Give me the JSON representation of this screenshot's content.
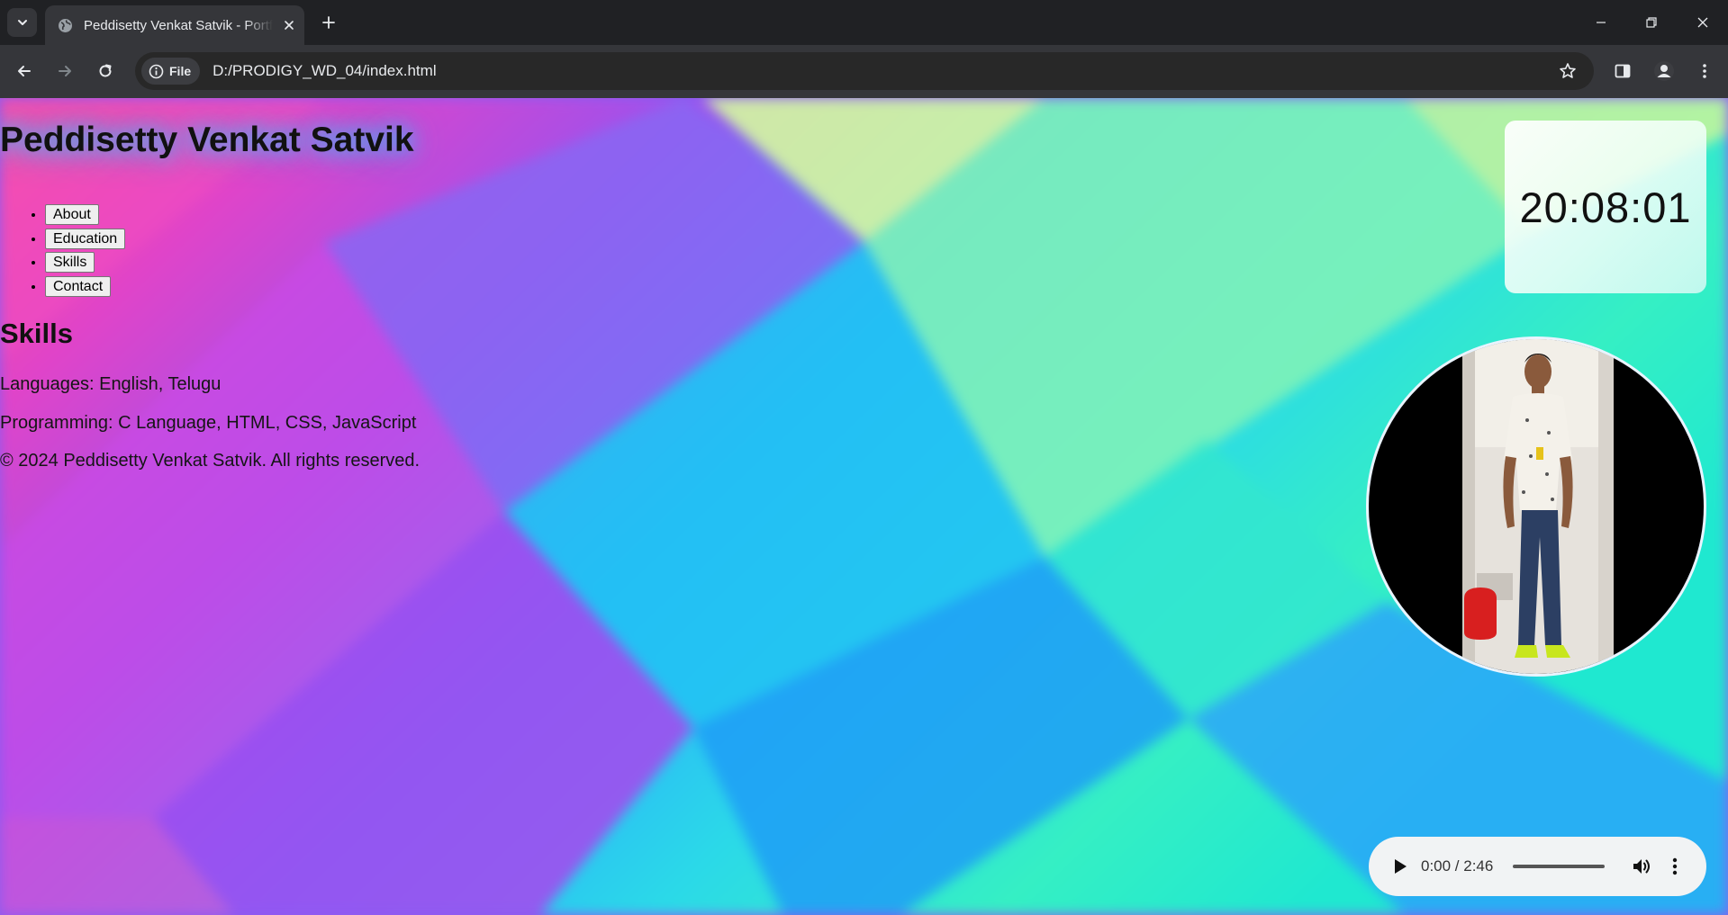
{
  "browser": {
    "tab_title": "Peddisetty Venkat Satvik - Portfolio",
    "site_chip_label": "File",
    "url": "D:/PRODIGY_WD_04/index.html"
  },
  "page": {
    "heading": "Peddisetty Venkat Satvik",
    "nav_items": [
      {
        "label": "About"
      },
      {
        "label": "Education"
      },
      {
        "label": "Skills"
      },
      {
        "label": "Contact"
      }
    ],
    "section_title": "Skills",
    "skills": [
      {
        "text": "Languages: English, Telugu"
      },
      {
        "text": "Programming: C Language, HTML, CSS, JavaScript"
      }
    ],
    "footer": "© 2024 Peddisetty Venkat Satvik. All rights reserved.",
    "clock": "20:08:01",
    "audio": {
      "time": "0:00 / 2:46",
      "progress": 0
    },
    "colors": {
      "heading_glow": "#2ec4ff",
      "clock_card": "#f4fff9",
      "audio_bg": "#f1f3f4"
    },
    "icons": {
      "play": "play-icon",
      "volume": "volume-icon",
      "more": "more-vert-icon"
    }
  }
}
